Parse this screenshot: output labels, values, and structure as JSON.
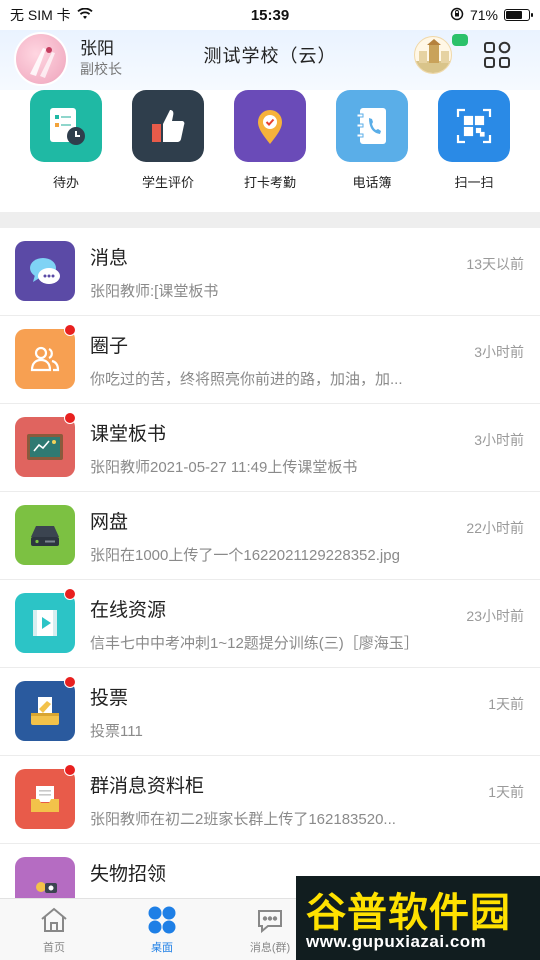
{
  "status_bar": {
    "carrier": "无 SIM 卡",
    "time": "15:39",
    "battery_percent": "71%",
    "battery_level": 0.71
  },
  "header": {
    "user_name": "张阳",
    "user_role": "副校长",
    "school_name": "测试学校（云）"
  },
  "quick_actions": [
    {
      "label": "待办",
      "icon": "todo-clipboard-icon",
      "color": "#1fb9a4"
    },
    {
      "label": "学生评价",
      "icon": "thumbs-up-icon",
      "color": "#2f3e4c"
    },
    {
      "label": "打卡考勤",
      "icon": "location-pin-icon",
      "color": "#6a4bb8"
    },
    {
      "label": "电话簿",
      "icon": "phonebook-icon",
      "color": "#5aaee8"
    },
    {
      "label": "扫一扫",
      "icon": "qr-scan-icon",
      "color": "#2a8ae6"
    }
  ],
  "messages": [
    {
      "title": "消息",
      "subtitle": "张阳教师:[课堂板书",
      "time": "13天以前",
      "unread": false,
      "icon": "chat-bubbles-icon",
      "color": "#5b4aa6"
    },
    {
      "title": "圈子",
      "subtitle": "你吃过的苦，终将照亮你前进的路，加油，加...",
      "time": "3小时前",
      "unread": true,
      "icon": "people-icon",
      "color": "#f7a052"
    },
    {
      "title": "课堂板书",
      "subtitle": "张阳教师2021-05-27 11:49上传课堂板书",
      "time": "3小时前",
      "unread": true,
      "icon": "blackboard-icon",
      "color": "#e0645f"
    },
    {
      "title": "网盘",
      "subtitle": "张阳在1000上传了一个1622021129228352.jpg",
      "time": "22小时前",
      "unread": false,
      "icon": "hard-drive-icon",
      "color": "#7cc142"
    },
    {
      "title": "在线资源",
      "subtitle": "信丰七中中考冲刺1~12题提分训练(三)［廖海玉］",
      "time": "23小时前",
      "unread": true,
      "icon": "video-play-icon",
      "color": "#2cc4c6"
    },
    {
      "title": "投票",
      "subtitle": "投票111",
      "time": "1天前",
      "unread": true,
      "icon": "vote-box-icon",
      "color": "#2a5a9e"
    },
    {
      "title": "群消息资料柜",
      "subtitle": "张阳教师在初二2班家长群上传了162183520...",
      "time": "1天前",
      "unread": true,
      "icon": "file-cabinet-icon",
      "color": "#e85b4a"
    },
    {
      "title": "失物招领",
      "subtitle": "",
      "time": "",
      "unread": false,
      "icon": "lost-found-icon",
      "color": "#b56cc2"
    }
  ],
  "tabbar": [
    {
      "label": "首页",
      "icon": "home-icon",
      "active": false
    },
    {
      "label": "桌面",
      "icon": "desktop-grid-icon",
      "active": true
    },
    {
      "label": "消息(群)",
      "icon": "message-icon",
      "active": false
    }
  ],
  "watermark": {
    "title": "谷普软件园",
    "url": "www.gupuxiazai.com"
  },
  "accent_color": "#1e7fe6"
}
